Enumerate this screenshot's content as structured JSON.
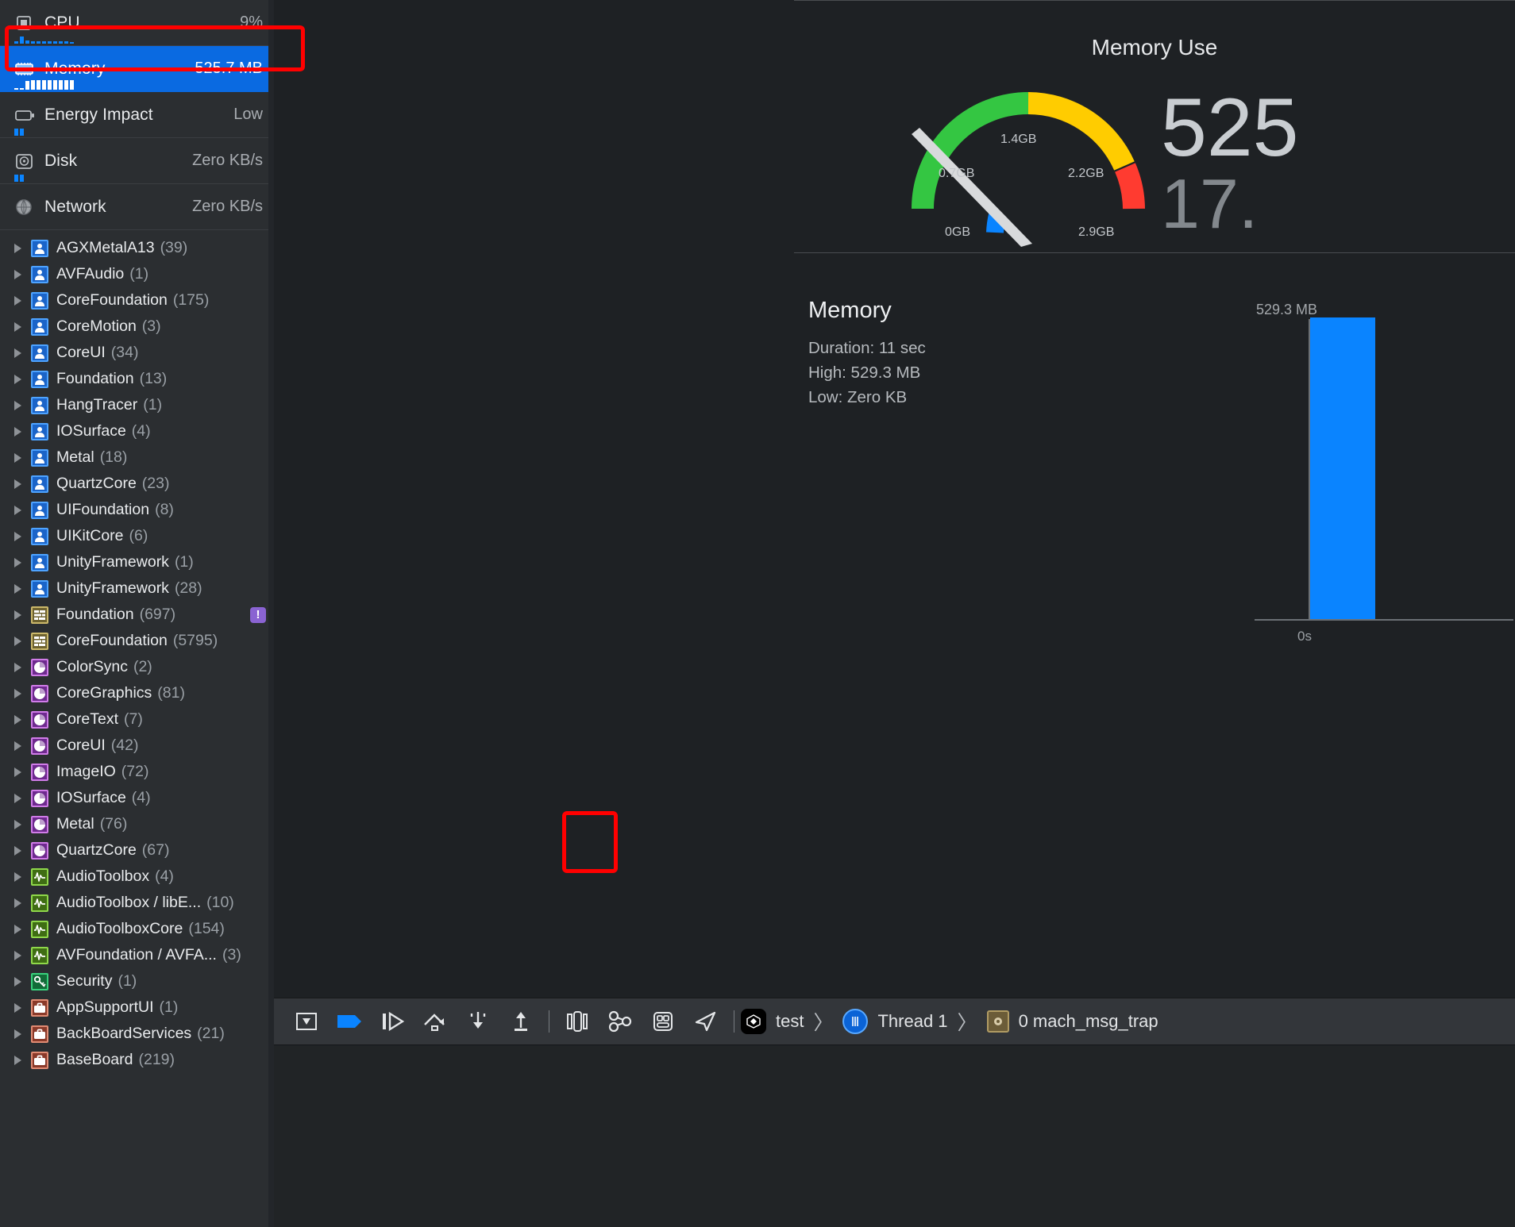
{
  "navigator": {
    "gauges": [
      {
        "label": "CPU",
        "value": "9%",
        "icon": "cpu-chip-icon",
        "selected": false,
        "spark": [
          3,
          9,
          4,
          3,
          3,
          3,
          3,
          3,
          3,
          3,
          2
        ]
      },
      {
        "label": "Memory",
        "value": "525.7 MB",
        "icon": "memory-chip-icon",
        "selected": true,
        "spark": [
          2,
          2,
          11,
          12,
          12,
          12,
          12,
          12,
          12,
          12,
          12
        ]
      },
      {
        "label": "Energy Impact",
        "value": "Low",
        "icon": "battery-icon",
        "selected": false,
        "spark": [
          9,
          9
        ]
      },
      {
        "label": "Disk",
        "value": "Zero KB/s",
        "icon": "disk-icon",
        "selected": false,
        "spark": [
          9,
          9
        ]
      },
      {
        "label": "Network",
        "value": "Zero KB/s",
        "icon": "network-globe-icon",
        "selected": false,
        "spark": []
      }
    ],
    "libraries": [
      {
        "name": "AGXMetalA13",
        "count": "(39)",
        "kind": "person"
      },
      {
        "name": "AVFAudio",
        "count": "(1)",
        "kind": "person"
      },
      {
        "name": "CoreFoundation",
        "count": "(175)",
        "kind": "person"
      },
      {
        "name": "CoreMotion",
        "count": "(3)",
        "kind": "person"
      },
      {
        "name": "CoreUI",
        "count": "(34)",
        "kind": "person"
      },
      {
        "name": "Foundation",
        "count": "(13)",
        "kind": "person"
      },
      {
        "name": "HangTracer",
        "count": "(1)",
        "kind": "person"
      },
      {
        "name": "IOSurface",
        "count": "(4)",
        "kind": "person"
      },
      {
        "name": "Metal",
        "count": "(18)",
        "kind": "person"
      },
      {
        "name": "QuartzCore",
        "count": "(23)",
        "kind": "person"
      },
      {
        "name": "UIFoundation",
        "count": "(8)",
        "kind": "person"
      },
      {
        "name": "UIKitCore",
        "count": "(6)",
        "kind": "person"
      },
      {
        "name": "UnityFramework",
        "count": "(1)",
        "kind": "person"
      },
      {
        "name": "UnityFramework",
        "count": "(28)",
        "kind": "person"
      },
      {
        "name": "Foundation",
        "count": "(697)",
        "kind": "brick",
        "badge": "!"
      },
      {
        "name": "CoreFoundation",
        "count": "(5795)",
        "kind": "brick"
      },
      {
        "name": "ColorSync",
        "count": "(2)",
        "kind": "pie"
      },
      {
        "name": "CoreGraphics",
        "count": "(81)",
        "kind": "pie"
      },
      {
        "name": "CoreText",
        "count": "(7)",
        "kind": "pie"
      },
      {
        "name": "CoreUI",
        "count": "(42)",
        "kind": "pie"
      },
      {
        "name": "ImageIO",
        "count": "(72)",
        "kind": "pie"
      },
      {
        "name": "IOSurface",
        "count": "(4)",
        "kind": "pie"
      },
      {
        "name": "Metal",
        "count": "(76)",
        "kind": "pie"
      },
      {
        "name": "QuartzCore",
        "count": "(67)",
        "kind": "pie"
      },
      {
        "name": "AudioToolbox",
        "count": "(4)",
        "kind": "wave"
      },
      {
        "name": "AudioToolbox / libE...",
        "count": "(10)",
        "kind": "wave"
      },
      {
        "name": "AudioToolboxCore",
        "count": "(154)",
        "kind": "wave"
      },
      {
        "name": "AVFoundation / AVFA...",
        "count": "(3)",
        "kind": "wave"
      },
      {
        "name": "Security",
        "count": "(1)",
        "kind": "key"
      },
      {
        "name": "AppSupportUI",
        "count": "(1)",
        "kind": "case"
      },
      {
        "name": "BackBoardServices",
        "count": "(21)",
        "kind": "case"
      },
      {
        "name": "BaseBoard",
        "count": "(219)",
        "kind": "case"
      }
    ]
  },
  "gauge_panel": {
    "title": "Memory Use",
    "big_value": "525",
    "sub_value": "17.",
    "tick_labels": [
      "0GB",
      "0.7GB",
      "1.4GB",
      "2.2GB",
      "2.9GB"
    ],
    "colors": {
      "green": "#34c642",
      "yellow": "#ffcc00",
      "red": "#ff3b30",
      "blue": "#0a84ff",
      "needle": "#d8dadc"
    }
  },
  "memory_detail": {
    "heading": "Memory",
    "duration": "Duration: 11 sec",
    "high": "High: 529.3 MB",
    "low": "Low: Zero KB",
    "peak_label": "529.3 MB"
  },
  "chart_data": {
    "type": "bar",
    "title": "Memory",
    "categories": [
      "0s"
    ],
    "values": [
      529.3
    ],
    "xlabel": "",
    "ylabel": "",
    "ylim": [
      0,
      529.3
    ],
    "unit": "MB",
    "series_color": "#0a84ff",
    "annotations": [
      "529.3 MB"
    ],
    "grid": false,
    "legend": "none"
  },
  "debug_bar": {
    "buttons": [
      {
        "name": "hide-debug-area-button",
        "icon": "panel-collapse-icon"
      },
      {
        "name": "deactivate-breakpoints-button",
        "icon": "breakpoint-arrow-icon"
      },
      {
        "name": "continue-button",
        "icon": "continue-play-icon"
      },
      {
        "name": "step-over-button",
        "icon": "step-over-icon"
      },
      {
        "name": "step-into-button",
        "icon": "step-into-icon"
      },
      {
        "name": "step-out-button",
        "icon": "step-out-icon"
      },
      {
        "name": "debug-view-hierarchy-button",
        "icon": "view-hierarchy-icon"
      },
      {
        "name": "debug-memory-graph-button",
        "icon": "memory-graph-icon"
      },
      {
        "name": "environment-overrides-button",
        "icon": "environment-overrides-icon"
      },
      {
        "name": "simulate-location-button",
        "icon": "location-arrow-icon"
      }
    ],
    "breadcrumb": {
      "process": "test",
      "thread": "Thread 1",
      "frame": "0 mach_msg_trap",
      "separator": "〉"
    }
  }
}
